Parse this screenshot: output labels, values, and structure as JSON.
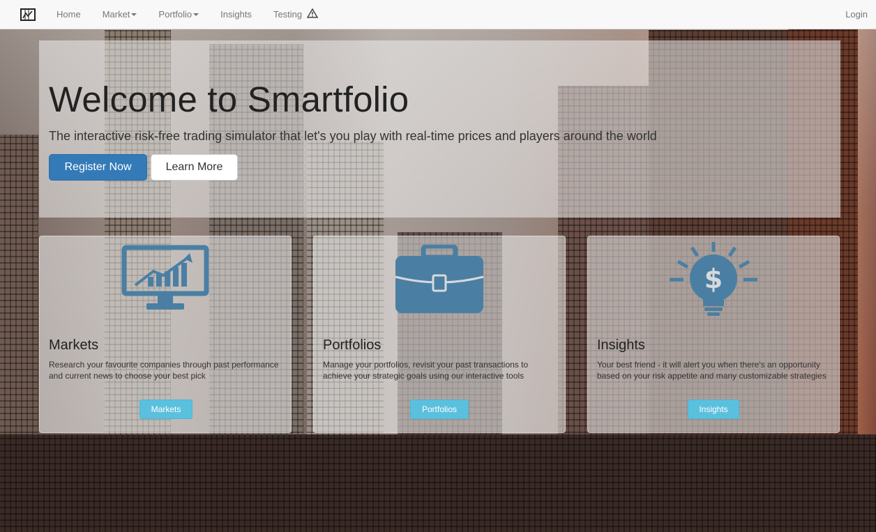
{
  "colors": {
    "navbar_bg": "#f8f8f8",
    "primary": "#337ab7",
    "info": "#5bc0de",
    "icon_blue": "#4a7fa3"
  },
  "navbar": {
    "brand_icon": "chart-frame-icon",
    "items": [
      {
        "label": "Home"
      },
      {
        "label": "Market",
        "dropdown": true
      },
      {
        "label": "Portfolio",
        "dropdown": true
      },
      {
        "label": "Insights"
      },
      {
        "label": "Testing",
        "icon": "warning-icon"
      }
    ],
    "login": "Login"
  },
  "hero": {
    "title": "Welcome to Smartfolio",
    "subtitle": "The interactive risk-free trading simulator that let's you play with real-time prices and players around the world",
    "register_label": "Register Now",
    "learn_more_label": "Learn More"
  },
  "cards": [
    {
      "icon": "chart-monitor-icon",
      "title": "Markets",
      "description": "Research your favourite companies through past performance and current news to choose your best pick",
      "button": "Markets"
    },
    {
      "icon": "briefcase-icon",
      "title": "Portfolios",
      "description": "Manage your portfolios, revisit your past transactions to achieve your strategic goals using our interactive tools",
      "button": "Portfolios"
    },
    {
      "icon": "dollar-lightbulb-icon",
      "title": "Insights",
      "description": "Your best friend - it will alert you when there's an opportunity based on your risk appetite and many customizable strategies",
      "button": "Insights"
    }
  ]
}
